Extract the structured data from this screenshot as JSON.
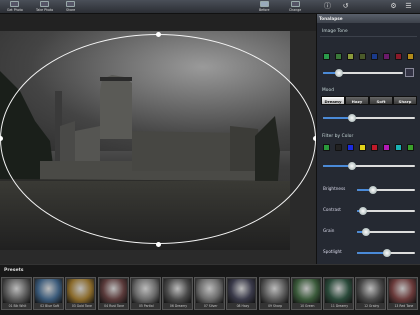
{
  "toolbar": {
    "get_photo": "Get Photo",
    "take_photo": "Take Photo",
    "share": "Share",
    "before": "Before",
    "change": "Change"
  },
  "icons": [
    "info-icon",
    "undo-icon",
    "gear-icon",
    "list-icon"
  ],
  "panel": {
    "title": "Tonalapse",
    "image_tone_label": "Image Tone",
    "tone_colors": [
      "#2a9a4a",
      "#3b7a3a",
      "#8a9a3b",
      "#4a5a2a",
      "#1a3a8a",
      "#6a1a6a",
      "#8a1a2a",
      "#b28a1a"
    ],
    "tone_value": 0.2,
    "mood_label": "Mood",
    "moods": [
      "Dreamy",
      "Hazy",
      "Soft",
      "Sharp"
    ],
    "mood_selected": "Dreamy",
    "mood_value": 0.32,
    "filter_label": "Filter by Color",
    "filter_colors": [
      "#2a9a3b",
      "#222222",
      "#1a2ae0",
      "#e0d21a",
      "#c01a2a",
      "#b21ab5",
      "#1ab2b5",
      "#3aa02a"
    ],
    "filter_value": 0.32,
    "adjustments": [
      {
        "label": "Brightness",
        "value": 0.28
      },
      {
        "label": "Contrast",
        "value": 0.1
      },
      {
        "label": "Grain",
        "value": 0.15
      },
      {
        "label": "Spotlight",
        "value": 0.52
      }
    ]
  },
  "presets": {
    "title": "Presets",
    "items": [
      {
        "label": "01 Blk Whit",
        "tint": "#5a5a5a"
      },
      {
        "label": "02 Blue Soft",
        "tint": "#3a5a7a"
      },
      {
        "label": "03 Gold Tone",
        "tint": "#8a6a2a"
      },
      {
        "label": "04 Rust Tone",
        "tint": "#5a3a3a"
      },
      {
        "label": "05 Partial",
        "tint": "#6a6a6a"
      },
      {
        "label": "06 Dreamy",
        "tint": "#4a4a4a"
      },
      {
        "label": "07 Silver",
        "tint": "#6a6a6a"
      },
      {
        "label": "08 Hazy",
        "tint": "#3a3a4a"
      },
      {
        "label": "09 Sharp",
        "tint": "#5a5a5a"
      },
      {
        "label": "10 Green",
        "tint": "#3a5a3a"
      },
      {
        "label": "11 Dreamy",
        "tint": "#2a4a3a"
      },
      {
        "label": "12 Grainy",
        "tint": "#4a4a4a"
      },
      {
        "label": "13 Red Tone",
        "tint": "#6a3a3a"
      }
    ]
  }
}
